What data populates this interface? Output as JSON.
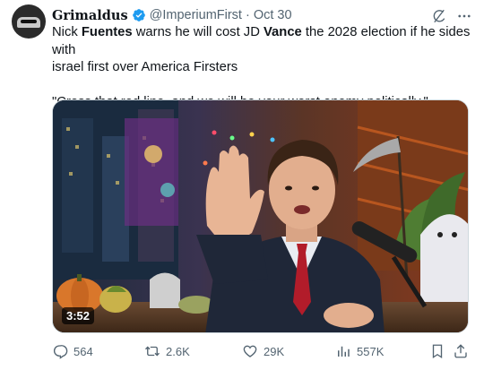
{
  "author": {
    "name": "Grimaldus",
    "handle": "@ImperiumFirst",
    "separator": "·",
    "date": "Oct 30"
  },
  "tweet": {
    "line1_parts": [
      "Nick ",
      "Fuentes",
      " warns he will cost JD ",
      "Vance",
      " the 2028 election if he sides with"
    ],
    "line2": "israel first over America Firsters",
    "quote": "\"Cross that red line, and we will be your worst enemy politically.\""
  },
  "media": {
    "type": "video",
    "duration": "3:52"
  },
  "actions": {
    "replies": "564",
    "reposts": "2.6K",
    "likes": "29K",
    "views": "557K"
  },
  "icons": [
    "avatar",
    "verified-badge-icon",
    "grok-icon",
    "more-icon",
    "reply-icon",
    "repost-icon",
    "like-icon",
    "views-icon",
    "bookmark-icon",
    "share-icon"
  ],
  "colors": {
    "text": "#0f1419",
    "secondary": "#536471",
    "verified": "#1d9bf0"
  }
}
